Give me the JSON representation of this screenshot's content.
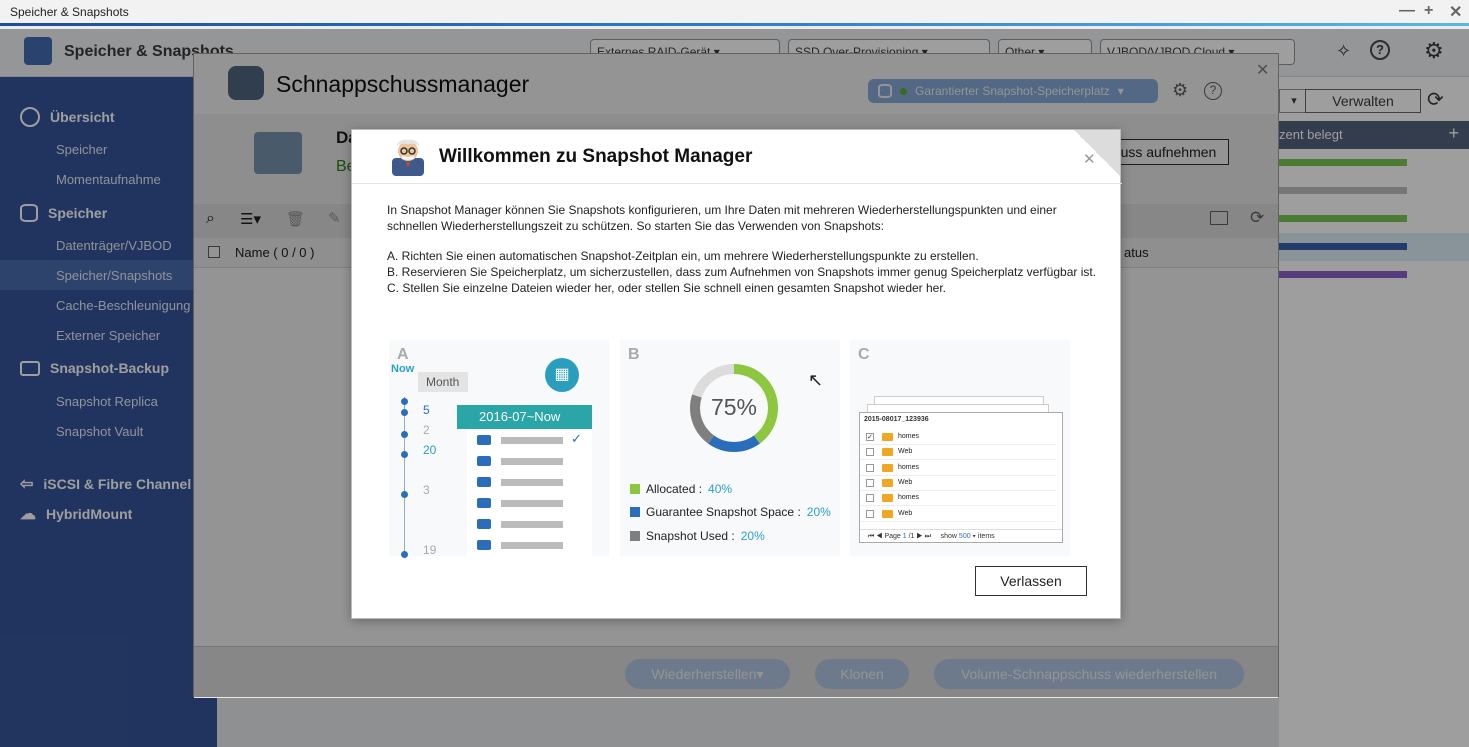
{
  "window": {
    "title": "Speicher & Snapshots"
  },
  "app": {
    "title": "Speicher & Snapshots",
    "header_menus": [
      "Externes RAID-Gerät",
      "SSD Over-Provisioning",
      "Other",
      "VJBOD/VJBOD Cloud"
    ]
  },
  "sidebar": {
    "sections": [
      {
        "label": "Übersicht",
        "items": [
          "Speicher",
          "Momentaufnahme"
        ]
      },
      {
        "label": "Speicher",
        "items": [
          "Datenträger/VJBOD",
          "Speicher/Snapshots",
          "Cache-Beschleunigung",
          "Externer Speicher"
        ]
      },
      {
        "label": "Snapshot-Backup",
        "items": [
          "Snapshot Replica",
          "Snapshot Vault"
        ]
      },
      {
        "label": "iSCSI & Fibre Channel",
        "items": []
      },
      {
        "label": "HybridMount",
        "items": []
      }
    ],
    "selected": "Speicher/Snapshots"
  },
  "background_panel": {
    "manage_label": "Verwalten",
    "column_label": "zent belegt",
    "status_label": "atus"
  },
  "snapshot_manager": {
    "title": "Schnappschussmanager",
    "pill_label": "Garantierter Snapshot-Speicherplatz",
    "obscured_title": "Da",
    "obscured_status": "Be",
    "take_snapshot_label": "nschuss aufnehmen",
    "name_column": "Name ( 0 / 0 )",
    "footer_buttons": [
      "Wiederherstellen▾",
      "Klonen",
      "Volume-Schnappschuss wiederherstellen"
    ]
  },
  "welcome_dialog": {
    "title": "Willkommen zu Snapshot Manager",
    "intro": "In Snapshot Manager können Sie Snapshots konfigurieren, um Ihre Daten mit mehreren Wiederherstellungspunkten und einer schnellen Wiederherstellungszeit zu schützen. So starten Sie das Verwenden von Snapshots:",
    "steps": [
      "A. Richten Sie einen automatischen Snapshot-Zeitplan ein, um mehrere Wiederherstellungspunkte zu erstellen.",
      "B. Reservieren Sie Speicherplatz, um sicherzustellen, dass zum Aufnehmen von Snapshots immer genug Speicherplatz verfügbar ist.",
      "C. Stellen Sie einzelne Dateien wieder her, oder stellen Sie schnell einen gesamten Snapshot wieder her."
    ],
    "panel_a": {
      "letter": "A",
      "now": "Now",
      "month": "Month",
      "range": "2016-07~Now",
      "counts": [
        "5",
        "2",
        "20",
        "3",
        "19"
      ]
    },
    "panel_b": {
      "letter": "B",
      "center": "75%",
      "legend": [
        {
          "label": "Allocated :",
          "value": "40%",
          "color": "#8dc63f"
        },
        {
          "label": "Guarantee Snapshot Space :",
          "value": "20%",
          "color": "#2a6ebb"
        },
        {
          "label": "Snapshot Used :",
          "value": "20%",
          "color": "#7f7f7f"
        }
      ],
      "donut_fractions": [
        0.4,
        0.2,
        0.2
      ]
    },
    "panel_c": {
      "letter": "C",
      "header_file": "2015-08017_123936",
      "rows": [
        "homes",
        "Web",
        "homes",
        "Web",
        "homes",
        "Web"
      ],
      "pager": {
        "page_label": "Page",
        "page": "1",
        "total": "/1",
        "show_label": "show",
        "show_value": "500",
        "items_label": "items"
      }
    },
    "leave_label": "Verlassen"
  }
}
